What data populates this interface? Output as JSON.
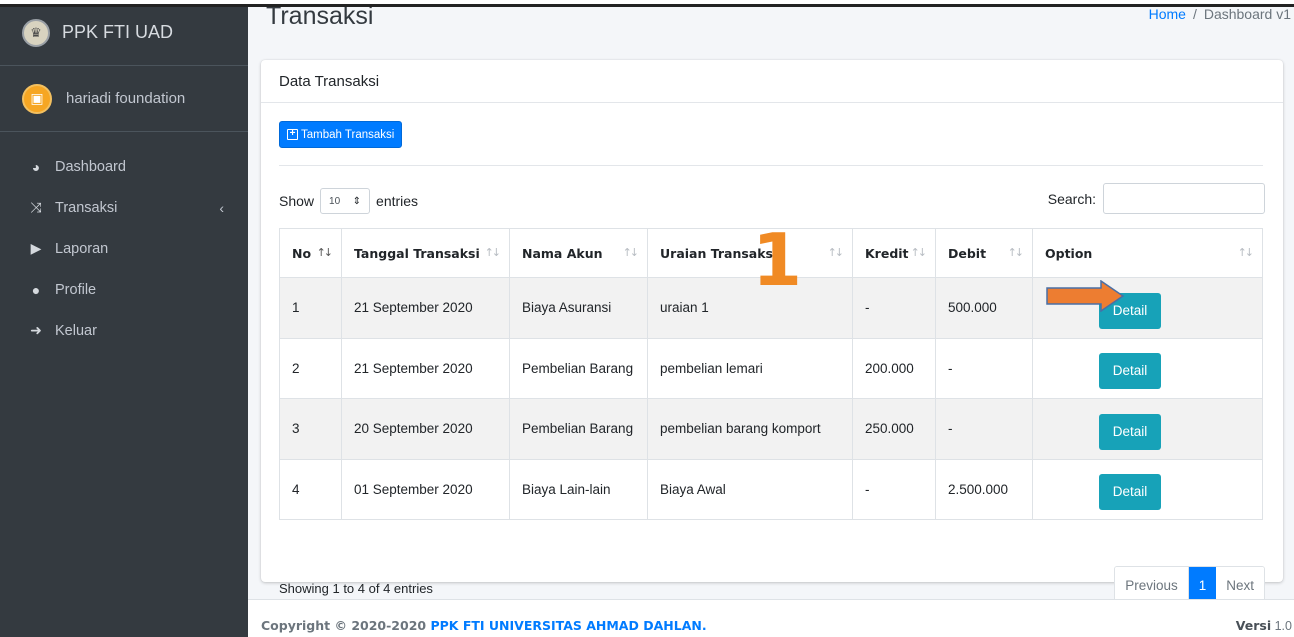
{
  "brand": {
    "title": "PPK FTI UAD"
  },
  "user": {
    "name": "hariadi foundation"
  },
  "sidebar": {
    "items": [
      {
        "label": "Dashboard",
        "icon": "tachometer-icon"
      },
      {
        "label": "Transaksi",
        "icon": "random-icon",
        "chevron": "‹"
      },
      {
        "label": "Laporan",
        "icon": "file-export-icon"
      },
      {
        "label": "Profile",
        "icon": "user-circle-icon"
      },
      {
        "label": "Keluar",
        "icon": "sign-out-icon"
      }
    ]
  },
  "page": {
    "title": "Transaksi"
  },
  "breadcrumb": {
    "home": "Home",
    "sep": "/",
    "current": "Dashboard v1"
  },
  "card": {
    "title": "Data Transaksi"
  },
  "toolbar": {
    "add_label": "Tambah Transaksi"
  },
  "entries": {
    "show_label": "Show",
    "length_value": "10",
    "entries_label": "entries"
  },
  "search": {
    "label": "Search:",
    "value": ""
  },
  "table": {
    "headers": [
      "No",
      "Tanggal Transaksi",
      "Nama Akun",
      "Uraian Transaksi",
      "Kredit",
      "Debit",
      "Option"
    ],
    "rows": [
      {
        "no": "1",
        "tanggal": "21 September 2020",
        "akun": "Biaya Asuransi",
        "uraian": "uraian 1",
        "kredit": "-",
        "debit": "500.000",
        "option": "Detail"
      },
      {
        "no": "2",
        "tanggal": "21 September 2020",
        "akun": "Pembelian Barang",
        "uraian": "pembelian lemari",
        "kredit": "200.000",
        "debit": "-",
        "option": "Detail"
      },
      {
        "no": "3",
        "tanggal": "20 September 2020",
        "akun": "Pembelian Barang",
        "uraian": "pembelian barang komport",
        "kredit": "250.000",
        "debit": "-",
        "option": "Detail"
      },
      {
        "no": "4",
        "tanggal": "01 September 2020",
        "akun": "Biaya Lain-lain",
        "uraian": "Biaya Awal",
        "kredit": "-",
        "debit": "2.500.000",
        "option": "Detail"
      }
    ]
  },
  "info": {
    "text": "Showing 1 to 4 of 4 entries"
  },
  "pagination": {
    "previous": "Previous",
    "current": "1",
    "next": "Next"
  },
  "footer": {
    "copyright": "Copyright © 2020-2020",
    "org": "PPK FTI UNIVERSITAS AHMAD DAHLAN.",
    "version_label": "Versi",
    "version": "1.0"
  },
  "annotation": {
    "number": "1",
    "color": "#f08a24"
  },
  "colors": {
    "sidebar": "#343a40",
    "primary": "#007bff",
    "info": "#17a2b8"
  }
}
